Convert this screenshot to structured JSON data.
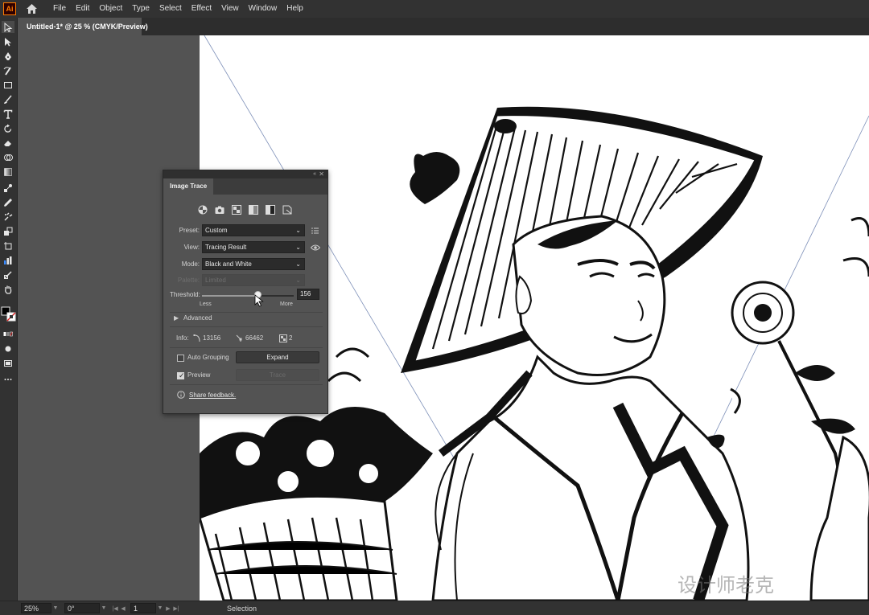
{
  "app": {
    "logo_text": "Ai",
    "menu": [
      "File",
      "Edit",
      "Object",
      "Type",
      "Select",
      "Effect",
      "View",
      "Window",
      "Help"
    ]
  },
  "document_tab": {
    "title": "Untitled-1* @ 25 % (CMYK/Preview)"
  },
  "tools": [
    "selection-tool",
    "direct-selection-tool",
    "pen-tool",
    "curvature-tool",
    "rectangle-tool",
    "paintbrush-tool",
    "type-tool",
    "rotate-tool",
    "eraser-tool",
    "shape-builder-tool",
    "gradient-tool",
    "eyedropper-tool",
    "blend-tool",
    "symbol-sprayer-tool",
    "artboard-tool",
    "slice-tool",
    "hand-tool",
    "zoom-tool"
  ],
  "image_trace": {
    "panel_title": "Image Trace",
    "preset_icons": [
      "auto-color-icon",
      "high-color-icon",
      "low-color-icon",
      "grayscale-icon",
      "black-and-white-icon",
      "outline-icon"
    ],
    "preset": {
      "label": "Preset:",
      "value": "Custom"
    },
    "view": {
      "label": "View:",
      "value": "Tracing Result"
    },
    "mode": {
      "label": "Mode:",
      "value": "Black and White"
    },
    "palette": {
      "label": "Palette:",
      "value": "Limited"
    },
    "threshold": {
      "label": "Threshold:",
      "value": "156",
      "min": 0,
      "max": 255,
      "less": "Less",
      "more": "More"
    },
    "advanced": "Advanced",
    "info": {
      "label": "Info:",
      "paths": "13156",
      "anchors": "66462",
      "colors": "2"
    },
    "auto_grouping": {
      "label": "Auto Grouping",
      "checked": false
    },
    "expand_label": "Expand",
    "preview": {
      "label": "Preview",
      "checked": true
    },
    "trace_label": "Trace",
    "feedback": "Share feedback."
  },
  "status": {
    "zoom": "25%",
    "rotation": "0°",
    "artboard": "1",
    "tool_name": "Selection"
  },
  "watermark": "设计师老克"
}
